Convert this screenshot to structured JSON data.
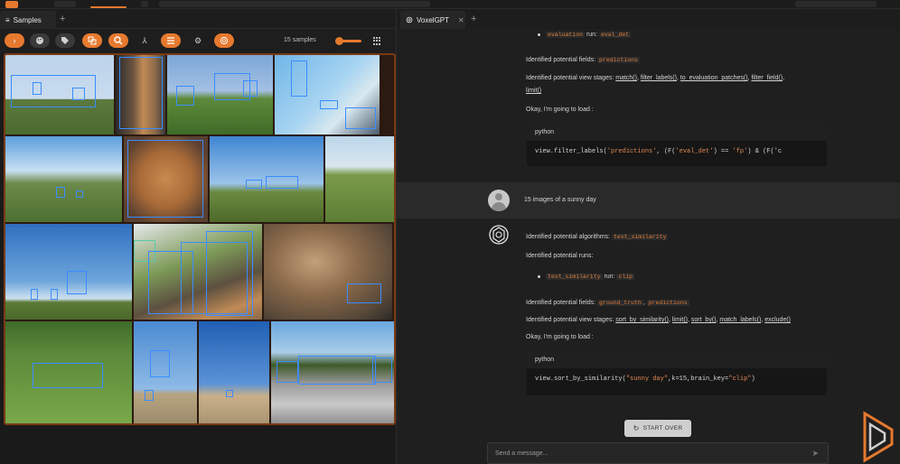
{
  "samples_tab": {
    "label": "Samples",
    "icon": "menu-icon"
  },
  "samples_count": "15 samples",
  "toolbar_icons": [
    "chevron-right-icon",
    "palette-icon",
    "tag-icon",
    "patches-icon",
    "search-icon",
    "merge-icon",
    "list-icon",
    "gear-icon",
    "openai-icon"
  ],
  "gpt_tab": {
    "label": "VoxelGPT",
    "close": "✕"
  },
  "tab_add": "+",
  "chat": {
    "run_line": {
      "prefix": "",
      "algo": "evaluation",
      "mid": " run: ",
      "run": "eval_det"
    },
    "fields_line_1": {
      "text": "Identified potential fields:",
      "fields": [
        "predictions"
      ]
    },
    "view_stages_1": {
      "text": "Identified potential view stages:",
      "stages": [
        "match()",
        "filter_labels()",
        "to_evaluation_patches()",
        "filter_field()",
        "limit()"
      ]
    },
    "load_1": "Okay, I'm going to load :",
    "code_1": {
      "lang": "python",
      "code_prefix": "view.filter_labels(",
      "s1": "'predictions'",
      "mid": ", (F(",
      "s2": "'eval_det'",
      "mid2": ") == ",
      "s3": "'fp'",
      "tail": ") & (F('c"
    },
    "user_message": "15 images of a sunny day",
    "algos_line": {
      "text": "Identified potential algorithms:",
      "algo": "text_similarity"
    },
    "runs_label": "Identified potential runs:",
    "run_line_2": {
      "algo": "text_similarity",
      "mid": " run: ",
      "run": "clip"
    },
    "fields_line_2": {
      "text": "Identified potential fields:",
      "fields": [
        "ground_truth",
        "predictions"
      ]
    },
    "view_stages_2": {
      "text": "Identified potential view stages:",
      "stages": [
        "sort_by_similarity()",
        "limit()",
        "sort_by()",
        "match_labels()",
        "exclude()"
      ]
    },
    "load_2": "Okay, I'm going to load :",
    "code_2": {
      "lang": "python",
      "code_prefix": "view.sort_by_similarity(",
      "s1": "\"sunny day\"",
      "mid": ",k=15,brain_key=",
      "s2": "\"clip\"",
      "tail": ")"
    }
  },
  "start_over": "START OVER",
  "message_placeholder": "Send a message...",
  "colors": {
    "accent": "#e6792e",
    "chip_text": "#e07b39",
    "bbox": "#3b8cff"
  }
}
